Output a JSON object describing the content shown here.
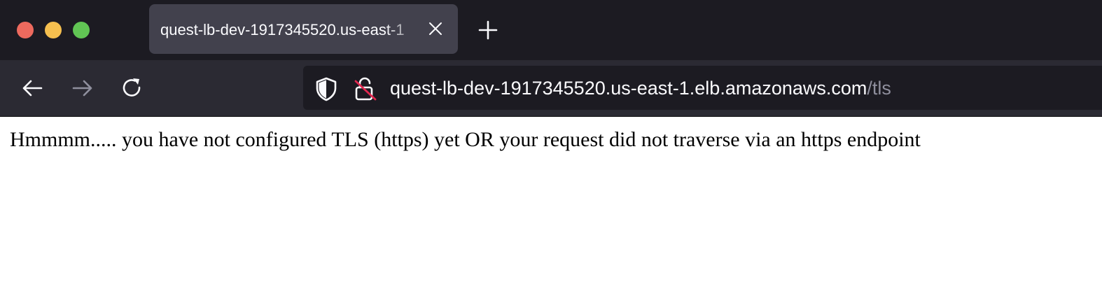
{
  "browser": {
    "window_controls": {
      "close_color": "#ed6a5e",
      "minimize_color": "#f5bf4f",
      "zoom_color": "#61c554"
    },
    "tab": {
      "title": "quest-lb-dev-1917345520.us-east-1"
    },
    "address_bar": {
      "host": "quest-lb-dev-1917345520.us-east-1.elb.amazonaws.com",
      "path": "/tls",
      "security_state": "not-secure"
    },
    "icons": {
      "back": "arrow-left-icon",
      "forward": "arrow-right-icon",
      "reload": "reload-icon",
      "tracking_protection": "shield-icon",
      "insecure": "lock-slash-icon",
      "close_tab": "close-icon",
      "new_tab": "plus-icon"
    },
    "colors": {
      "chrome_dark": "#1c1b22",
      "toolbar": "#2b2a33",
      "tab_active": "#42414d",
      "insecure_slash": "#e22850"
    }
  },
  "page": {
    "message": "Hmmmm..... you have not configured TLS (https) yet OR your request did not traverse via an https endpoint"
  }
}
